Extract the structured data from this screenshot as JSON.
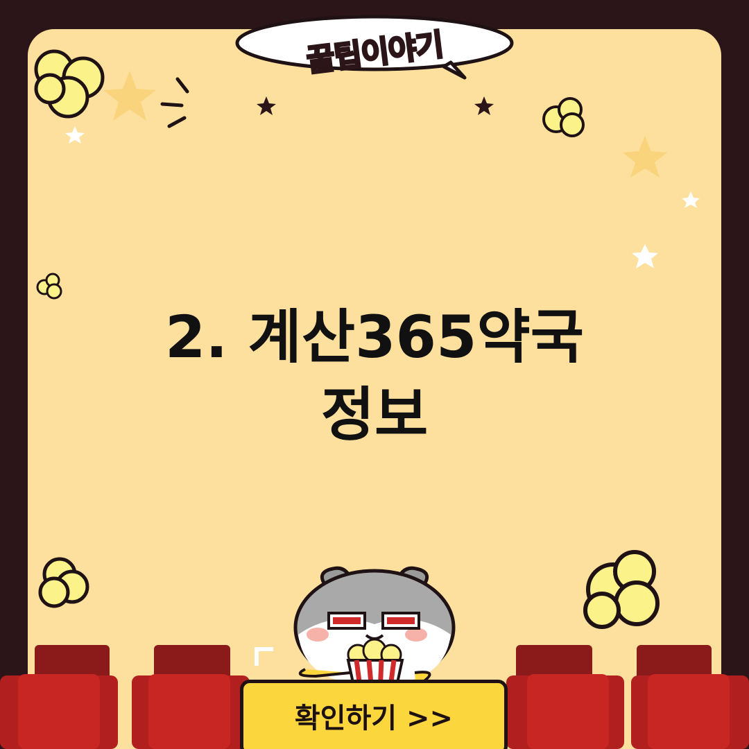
{
  "badge": {
    "text": "꿀팁이야기"
  },
  "title": {
    "line1": "2. 계산365약국",
    "line2": "정보"
  },
  "cta": {
    "label": "확인하기 >>"
  },
  "colors": {
    "frame": "#2b1518",
    "panel": "#fde09d",
    "cta_fill": "#fbd63d",
    "seat_red": "#c82622",
    "seat_dark": "#8b1a1a",
    "popcorn": "#fbf28a",
    "star_gold": "#f9d27a"
  },
  "icons": [
    "popcorn-icon",
    "star-icon",
    "hamster-mascot",
    "cinema-seat"
  ]
}
